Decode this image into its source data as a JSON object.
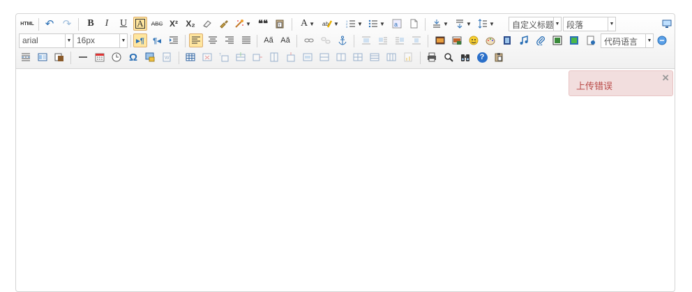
{
  "toolbar": {
    "html_label": "HTML",
    "bold": "B",
    "italic": "I",
    "underline": "U",
    "border_text": "A",
    "strike": "ABC",
    "superscript": "X²",
    "subscript": "X₂",
    "blockquote": "❝❝",
    "font_color": "A",
    "custom_title": "自定义标题",
    "paragraph": "段落",
    "font_family": "arial",
    "font_size": "16px",
    "code_language": "代码语言",
    "omega": "Ω",
    "help": "?"
  },
  "alert": {
    "message": "上传错误",
    "close": "×"
  },
  "colors": {
    "active_bg": "#ffe69f",
    "alert_bg": "#f2dede",
    "alert_text": "#b94a48"
  }
}
